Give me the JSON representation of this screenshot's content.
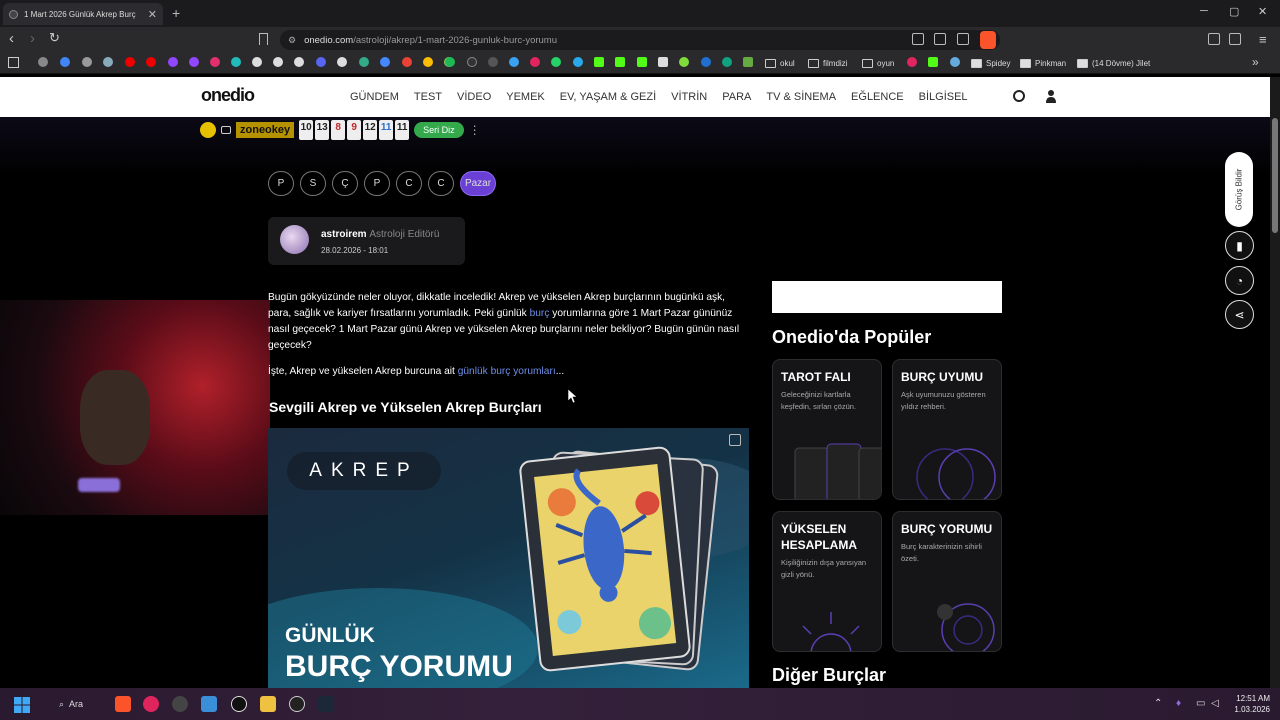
{
  "browser": {
    "tab_title": "1 Mart 2026 Günlük Akrep Burç",
    "tab_close": "✕",
    "new_tab": "+",
    "url_domain": "onedio.com",
    "url_path": "/astroloji/akrep/1-mart-2026-gunluk-burc-yorumu",
    "window_controls": [
      "─",
      "▢",
      "✕"
    ]
  },
  "bookmarks": {
    "folders": [
      "okul",
      "filmdizi",
      "oyun"
    ],
    "items": [
      "Spidey",
      "Pinkman",
      "(14 Dövme) Jilet"
    ],
    "overflow": "»"
  },
  "site": {
    "logo": "onedio",
    "nav": [
      "GÜNDEM",
      "TEST",
      "VİDEO",
      "YEMEK",
      "EV, YAŞAM & GEZİ",
      "VİTRİN",
      "PARA",
      "TV & SİNEMA",
      "EĞLENCE",
      "BİLGİSEL"
    ]
  },
  "zone_bar": {
    "logo": "zoneokey",
    "tiles": [
      "10",
      "13",
      "8",
      "9",
      "12",
      "11",
      "11"
    ],
    "tile_colors": [
      "#222",
      "#222",
      "#c0282c",
      "#c0282c",
      "#222",
      "#2a6fd0",
      "#222"
    ],
    "button": "Seri Diz"
  },
  "days": [
    "P",
    "S",
    "Ç",
    "P",
    "C",
    "C",
    "Pazar"
  ],
  "author": {
    "name": "astroirem",
    "role": "Astroloji Editörü",
    "date": "28.02.2026 - 18:01"
  },
  "article": {
    "p1_a": "Bugün gökyüzünde neler oluyor, dikkatle inceledik! Akrep ve yükselen Akrep burçlarının bugünkü aşk, para, sağlık ve kariyer fırsatlarını yorumladık. Peki günlük ",
    "p1_link": "burç",
    "p1_b": " yorumlarına göre 1 Mart Pazar gününüz nasıl geçecek? 1 Mart Pazar günü Akrep ve yükselen Akrep burçlarını neler bekliyor? Bugün günün nasıl geçecek?",
    "p2_a": "İşte, Akrep ve yükselen Akrep burcuna ait ",
    "p2_link": "günlük burç yorumları",
    "p2_b": "...",
    "section_heading": "Sevgili Akrep ve Yükselen Akrep Burçları"
  },
  "hero": {
    "sign": "AKREP",
    "line1": "GÜNLÜK",
    "line2": "BURÇ YORUMU"
  },
  "sidebar": {
    "popular_title": "Onedio'da Popüler",
    "cards": [
      {
        "title": "TAROT FALI",
        "desc": "Geleceğinizi kartlarla keşfedin, sırları çözün."
      },
      {
        "title": "BURÇ UYUMU",
        "desc": "Aşk uyumunuzu gösteren yıldız rehberi."
      },
      {
        "title": "YÜKSELEN HESAPLAMA",
        "desc": "Kişiliğinizin dışa yansıyan gizli yönü."
      },
      {
        "title": "BURÇ YORUMU",
        "desc": "Burç karakterinizin sihirli özeti."
      }
    ],
    "other_title": "Diğer Burçlar"
  },
  "right_actions": {
    "feedback": "Görüş Bildir"
  },
  "taskbar": {
    "search": "Ara",
    "time": "12:51 AM",
    "date": "1.03.2026"
  }
}
